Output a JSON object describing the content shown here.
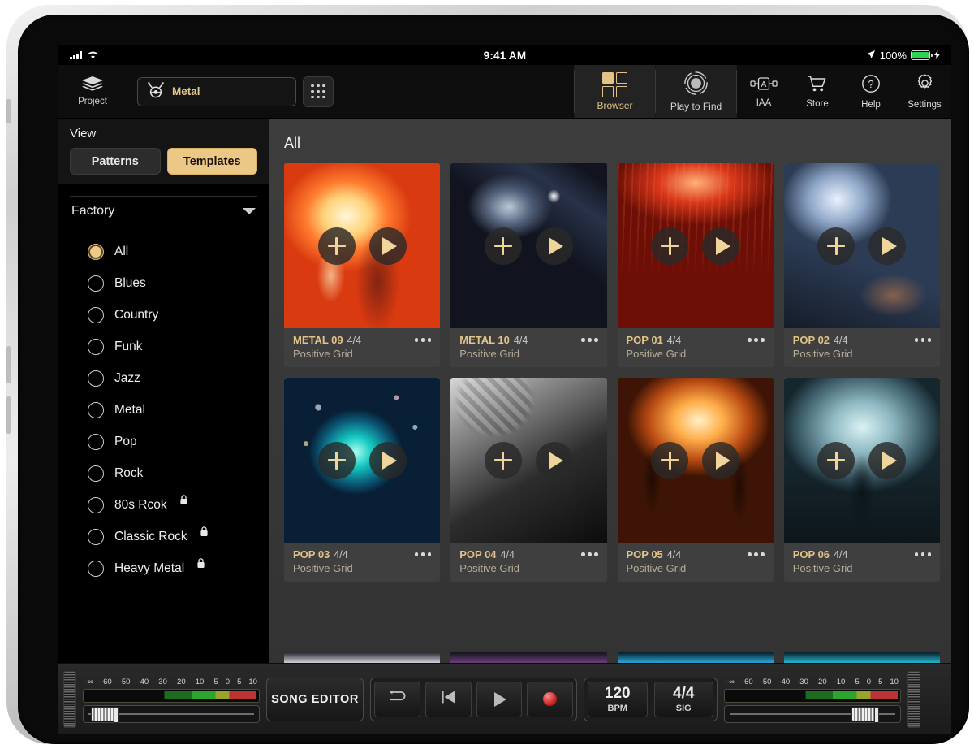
{
  "status_bar": {
    "time": "9:41 AM",
    "battery_percent": "100%",
    "signal_icon": "cellular-signal-icon",
    "wifi_icon": "wifi-icon",
    "location_icon": "location-arrow-icon",
    "battery_icon": "battery-icon",
    "charging_icon": "lightning-bolt-icon"
  },
  "toolbar": {
    "project_label": "Project",
    "project_icon": "layers-icon",
    "kit_name": "Metal",
    "kit_icon": "drum-kit-icon",
    "kit_grid_icon": "grid-dots-icon",
    "browser_label": "Browser",
    "browser_icon": "four-squares-icon",
    "play_to_find_label": "Play to Find",
    "play_to_find_icon": "radar-circle-icon",
    "right_items": [
      {
        "label": "IAA",
        "icon": "inter-app-audio-icon"
      },
      {
        "label": "Store",
        "icon": "shopping-cart-icon"
      },
      {
        "label": "Help",
        "icon": "question-circle-icon"
      },
      {
        "label": "Settings",
        "icon": "gear-icon"
      }
    ]
  },
  "sidebar": {
    "view_label": "View",
    "segments": [
      {
        "label": "Patterns",
        "selected": false
      },
      {
        "label": "Templates",
        "selected": true
      }
    ],
    "section_title": "Factory",
    "section_caret_icon": "chevron-down-icon",
    "genres": [
      {
        "label": "All",
        "selected": true,
        "locked": false
      },
      {
        "label": "Blues",
        "selected": false,
        "locked": false
      },
      {
        "label": "Country",
        "selected": false,
        "locked": false
      },
      {
        "label": "Funk",
        "selected": false,
        "locked": false
      },
      {
        "label": "Jazz",
        "selected": false,
        "locked": false
      },
      {
        "label": "Metal",
        "selected": false,
        "locked": false
      },
      {
        "label": "Pop",
        "selected": false,
        "locked": false
      },
      {
        "label": "Rock",
        "selected": false,
        "locked": false
      },
      {
        "label": "80s Rcok",
        "selected": false,
        "locked": true
      },
      {
        "label": "Classic Rock",
        "selected": false,
        "locked": true
      },
      {
        "label": "Heavy Metal",
        "selected": false,
        "locked": true
      }
    ]
  },
  "content": {
    "title": "All",
    "add_icon": "plus-icon",
    "play_icon": "play-icon",
    "more_icon": "ellipsis-icon",
    "cards": [
      {
        "name": "METAL 09",
        "signature": "4/4",
        "author": "Positive Grid",
        "art": "art-metal09"
      },
      {
        "name": "METAL 10",
        "signature": "4/4",
        "author": "Positive Grid",
        "art": "art-metal10"
      },
      {
        "name": "POP 01",
        "signature": "4/4",
        "author": "Positive Grid",
        "art": "art-pop01"
      },
      {
        "name": "POP 02",
        "signature": "4/4",
        "author": "Positive Grid",
        "art": "art-pop02"
      },
      {
        "name": "POP 03",
        "signature": "4/4",
        "author": "Positive Grid",
        "art": "art-pop03"
      },
      {
        "name": "POP 04",
        "signature": "4/4",
        "author": "Positive Grid",
        "art": "art-pop04"
      },
      {
        "name": "POP 05",
        "signature": "4/4",
        "author": "Positive Grid",
        "art": "art-pop05"
      },
      {
        "name": "POP 06",
        "signature": "4/4",
        "author": "Positive Grid",
        "art": "art-pop06"
      }
    ]
  },
  "transport": {
    "meter_scale": [
      "-∞",
      "-60",
      "-50",
      "-40",
      "-30",
      "-20",
      "-10",
      "-5",
      "0",
      "5",
      "10"
    ],
    "left_fader_position_pct": 6,
    "right_fader_position_pct": 74,
    "song_editor_label": "SONG EDITOR",
    "buttons": [
      {
        "icon": "loop-icon"
      },
      {
        "icon": "rewind-to-start-icon"
      },
      {
        "icon": "play-icon"
      },
      {
        "icon": "record-icon"
      }
    ],
    "bpm_value": "120",
    "bpm_unit": "BPM",
    "signature_value": "4/4",
    "signature_unit": "SIG"
  },
  "colors": {
    "accent_gold": "#e3c285",
    "selected_gold": "#ecc887",
    "record_red": "#c21f1f",
    "battery_green": "#2ad352"
  }
}
